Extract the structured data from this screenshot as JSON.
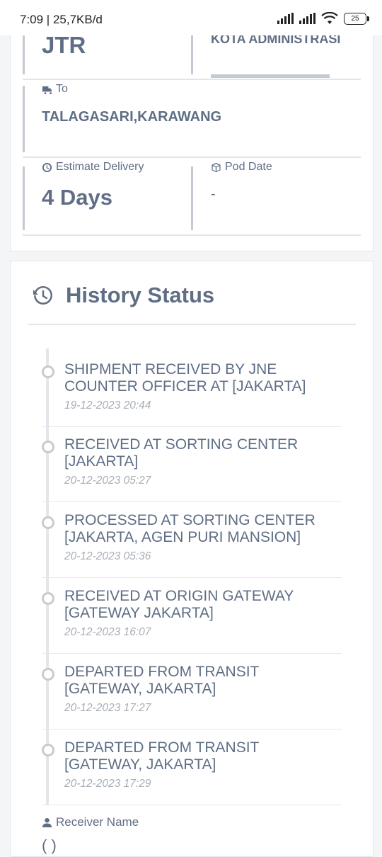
{
  "status_bar": {
    "time_speed": "7:09 | 25,7KB/d",
    "battery": "25"
  },
  "details": {
    "origin_code": "JTR",
    "destination_admin": "KOTA ADMINISTRASI",
    "to_label": "To",
    "to_value": "TALAGASARI,KARAWANG",
    "estimate_label": "Estimate Delivery",
    "estimate_value": "4 Days",
    "pod_label": "Pod Date",
    "pod_value": "-"
  },
  "history": {
    "title": "History Status",
    "events": [
      {
        "text": "SHIPMENT RECEIVED BY JNE COUNTER OFFICER AT [JAKARTA]",
        "date": "19-12-2023 20:44"
      },
      {
        "text": "RECEIVED AT SORTING CENTER [JAKARTA]",
        "date": "20-12-2023 05:27"
      },
      {
        "text": "PROCESSED AT SORTING CENTER [JAKARTA, AGEN PURI MANSION]",
        "date": "20-12-2023 05:36"
      },
      {
        "text": "RECEIVED AT ORIGIN GATEWAY [GATEWAY JAKARTA]",
        "date": "20-12-2023 16:07"
      },
      {
        "text": "DEPARTED FROM TRANSIT [GATEWAY, JAKARTA]",
        "date": "20-12-2023 17:27"
      },
      {
        "text": "DEPARTED FROM TRANSIT [GATEWAY, JAKARTA]",
        "date": "20-12-2023 17:29"
      }
    ],
    "receiver_label": "Receiver Name",
    "receiver_value": "( )"
  },
  "icons": {
    "truck": "truck-icon",
    "clock": "clock-icon",
    "box": "box-icon",
    "history": "history-icon",
    "user": "user-icon"
  }
}
